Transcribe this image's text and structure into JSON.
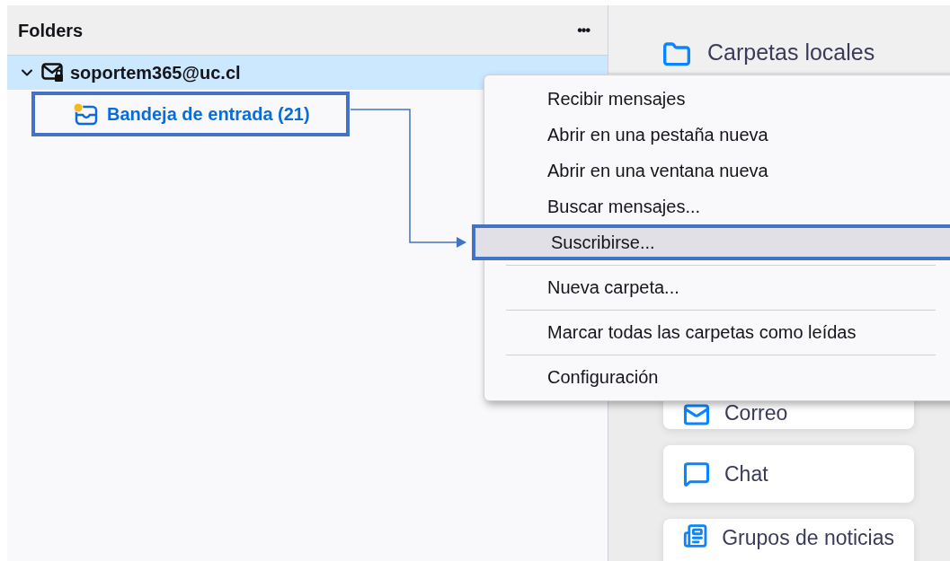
{
  "folder_pane": {
    "title": "Folders",
    "more_button": "•••",
    "accounts": [
      {
        "name": "soportem365@uc.cl",
        "selected": true,
        "expanded": true,
        "children": [
          {
            "name": "Bandeja de entrada (21)",
            "unread": true,
            "annotated": true
          }
        ]
      }
    ]
  },
  "account_hub": {
    "title": "Carpetas locales",
    "cards": [
      {
        "kind": "mail",
        "label": "Correo"
      },
      {
        "kind": "chat",
        "label": "Chat"
      },
      {
        "kind": "news",
        "label": "Grupos de noticias"
      }
    ]
  },
  "context_menu": [
    {
      "kind": "item",
      "label": "Recibir mensajes",
      "selected": false,
      "annotated": false
    },
    {
      "kind": "item",
      "label": "Abrir en una pestaña nueva",
      "selected": false,
      "annotated": false
    },
    {
      "kind": "item",
      "label": "Abrir en una ventana nueva",
      "selected": false,
      "annotated": false
    },
    {
      "kind": "item",
      "label": "Buscar mensajes...",
      "selected": false,
      "annotated": false
    },
    {
      "kind": "item",
      "label": "Suscribirse...",
      "selected": true,
      "annotated": true
    },
    {
      "kind": "separator"
    },
    {
      "kind": "item",
      "label": "Nueva carpeta...",
      "selected": false,
      "annotated": false
    },
    {
      "kind": "separator"
    },
    {
      "kind": "item",
      "label": "Marcar todas las carpetas como leídas",
      "selected": false,
      "annotated": false
    },
    {
      "kind": "separator"
    },
    {
      "kind": "item",
      "label": "Configuración",
      "selected": false,
      "annotated": false
    }
  ]
}
